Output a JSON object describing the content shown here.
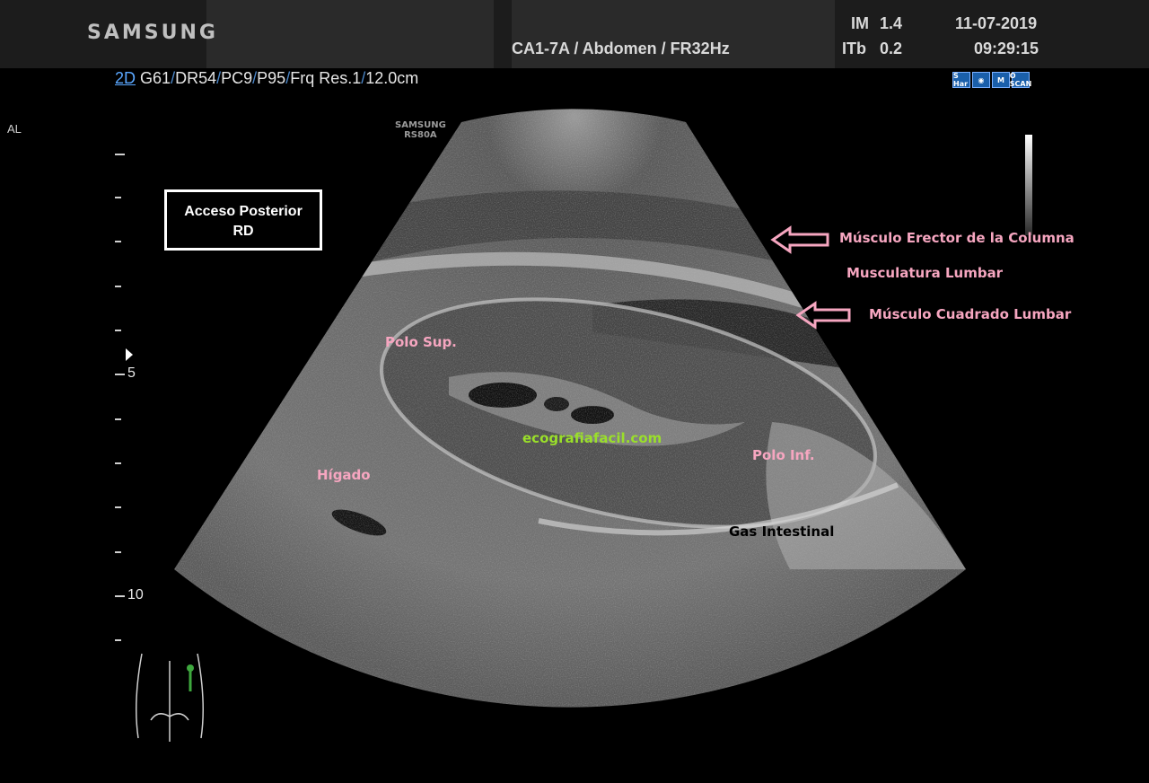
{
  "header": {
    "brand": "SAMSUNG",
    "probe_info": "CA1-7A / Abdomen / FR32Hz",
    "im_label": "IM",
    "im_value": "1.4",
    "itb_label": "ITb",
    "itb_value": "0.2",
    "date": "11-07-2019",
    "time": "09:29:15"
  },
  "params": {
    "mode": "2D",
    "items": [
      "G61",
      "DR54",
      "PC9",
      "P95",
      "Frq Res.1",
      "12.0cm"
    ]
  },
  "side_label": "AL",
  "probe_label_line1": "SAMSUNG",
  "probe_label_line2": "RS80A",
  "status_icons": [
    {
      "icon": "s-har-icon",
      "text": "S Har"
    },
    {
      "icon": "eye-icon",
      "text": "◉"
    },
    {
      "icon": "m-icon",
      "text": "M"
    },
    {
      "icon": "o-scan-icon",
      "text": "O SCAN"
    }
  ],
  "depth_markers": [
    "5",
    "10"
  ],
  "info_box": {
    "line1": "Acceso Posterior",
    "line2": "RD"
  },
  "annotations": {
    "erector": "Músculo Erector de la Columna",
    "lumbar": "Musculatura Lumbar",
    "cuadrado": "Músculo Cuadrado Lumbar",
    "polo_sup": "Polo Sup.",
    "polo_inf": "Polo Inf.",
    "higado": "Hígado",
    "gas": "Gas Intestinal",
    "watermark": "ecografiafacil.com"
  },
  "colors": {
    "annotation_pink": "#f6a6c0",
    "watermark_green": "#9adf2a",
    "mode_blue": "#5aa7ff"
  }
}
